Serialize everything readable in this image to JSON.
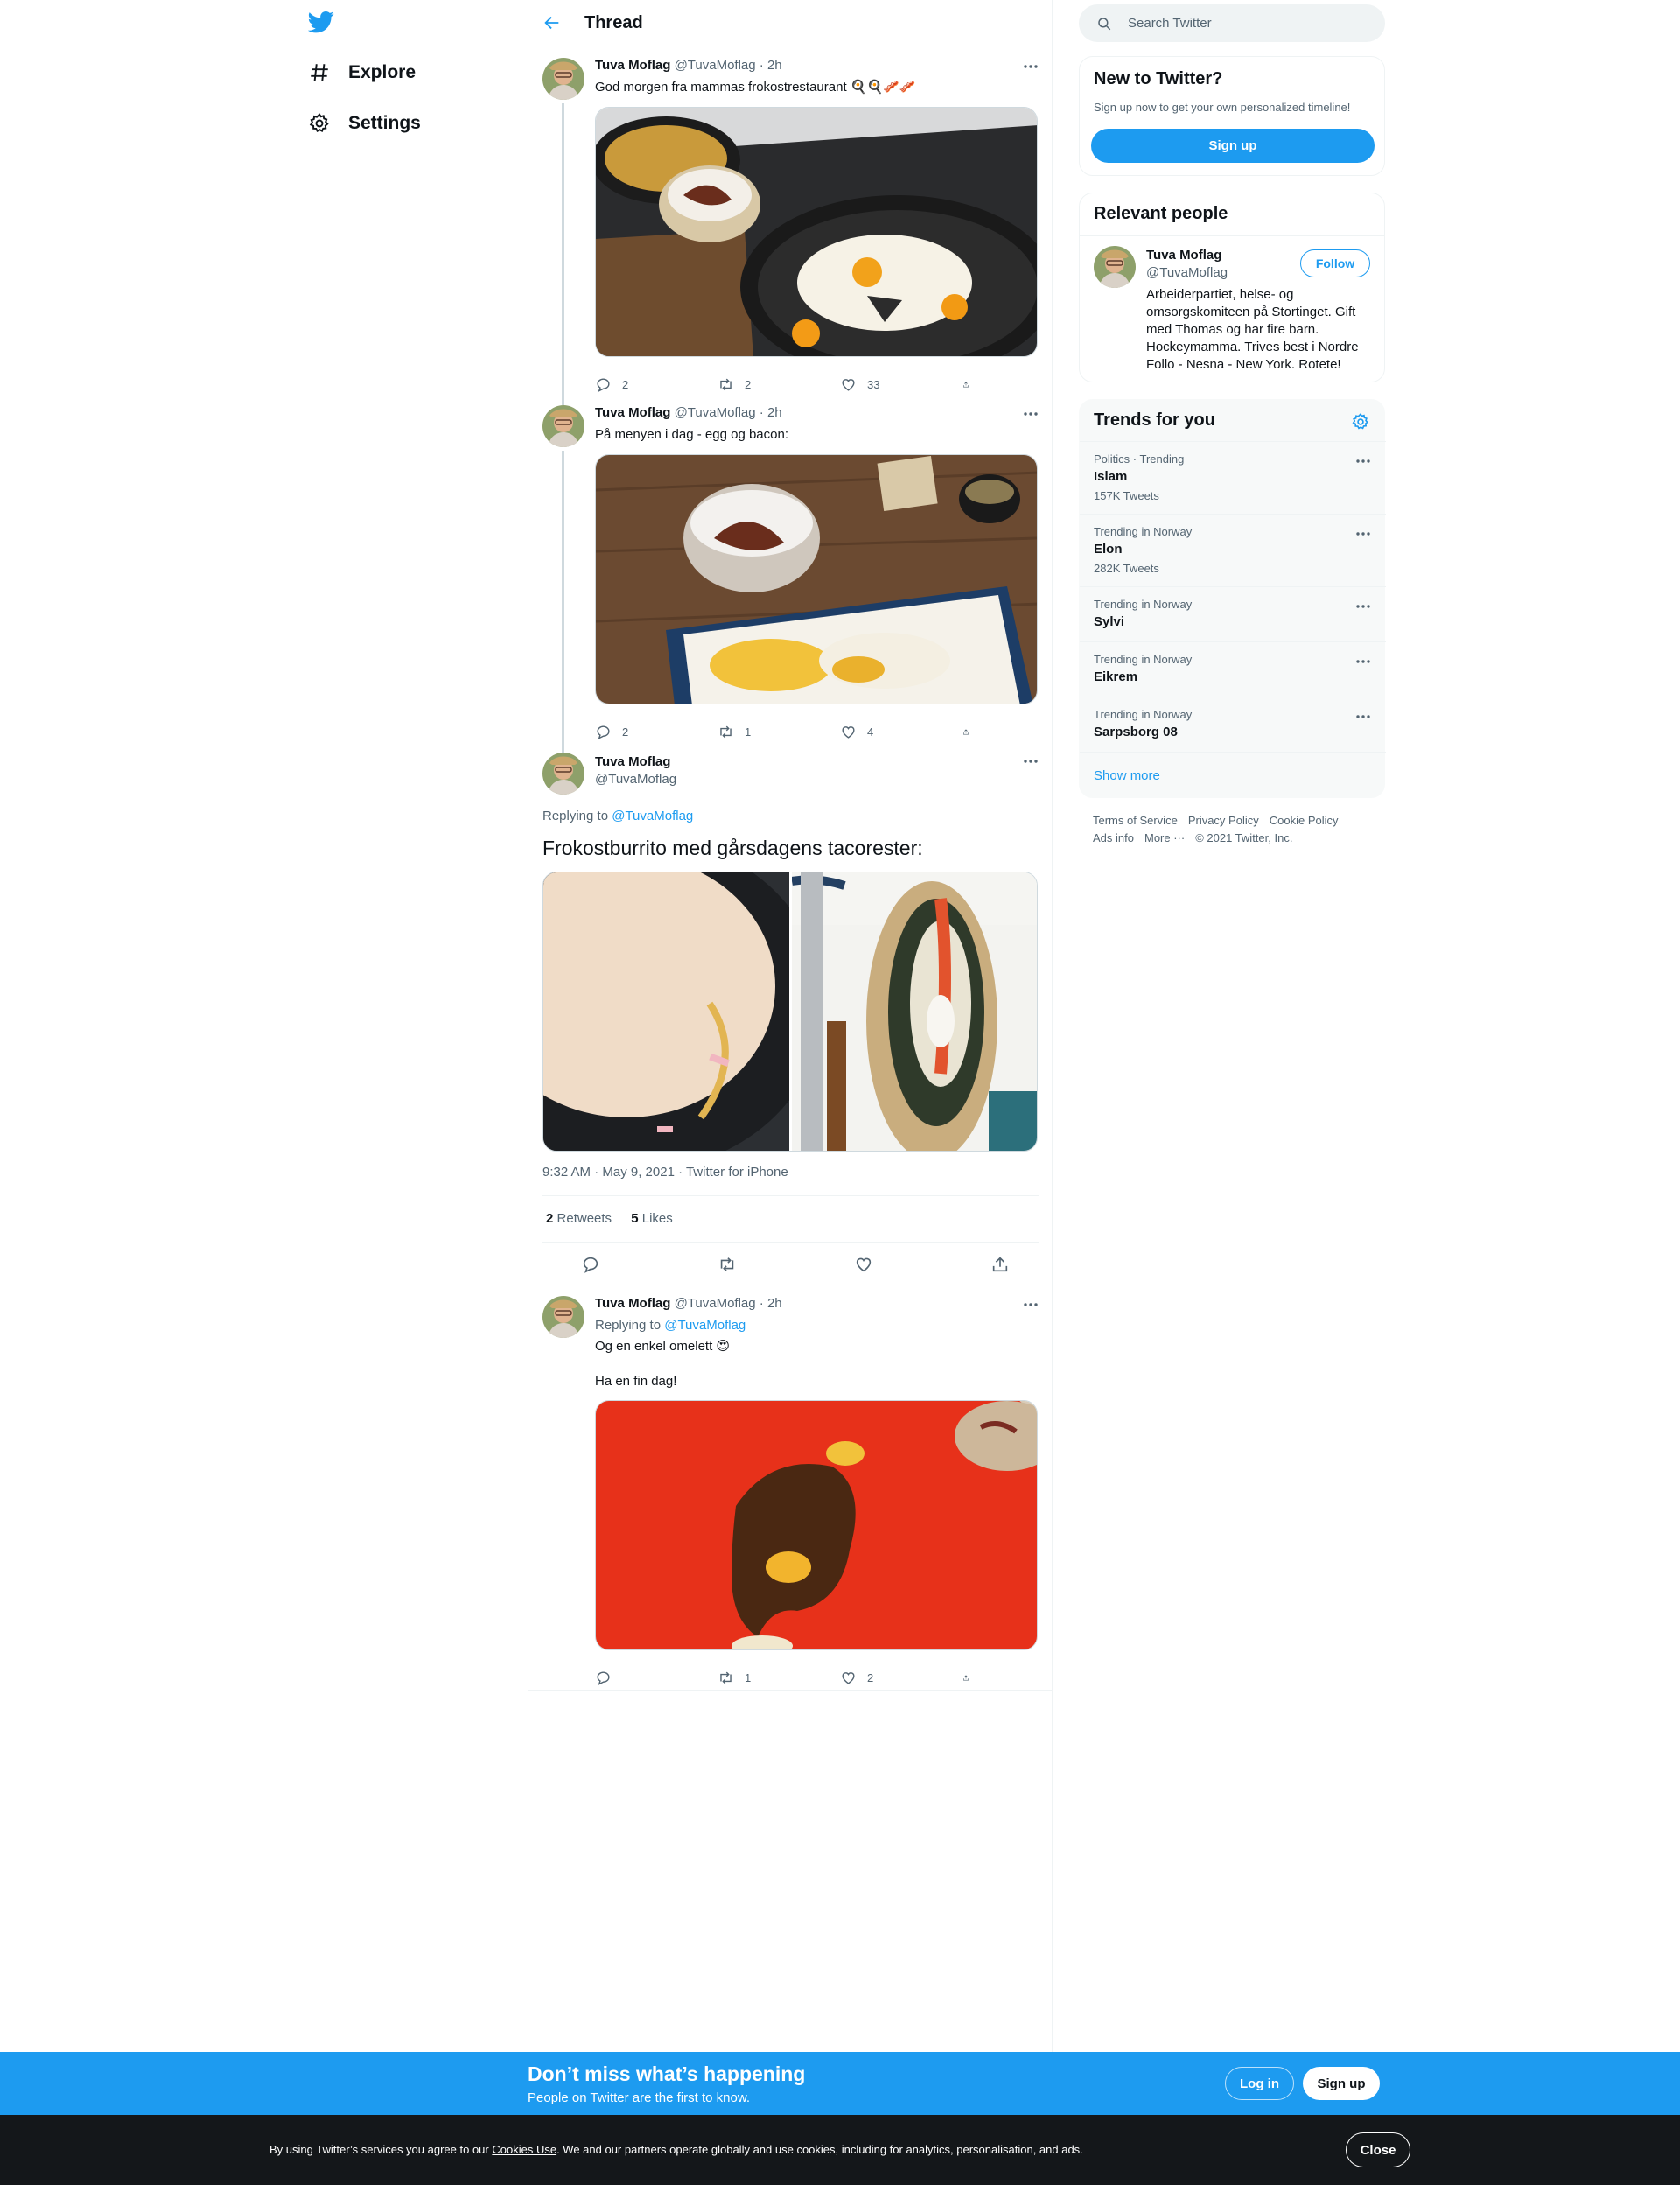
{
  "nav": {
    "logo": "twitter-bird-icon",
    "items": [
      {
        "label": "Explore",
        "icon": "hashtag-icon"
      },
      {
        "label": "Settings",
        "icon": "gear-icon"
      }
    ]
  },
  "header": {
    "title": "Thread"
  },
  "tweets": [
    {
      "name": "Tuva Moflag",
      "handle": "@TuvaMoflag",
      "time": "· 2h",
      "text": "God morgen fra mammas frokostrestaurant 🍳🍳🥓🥓",
      "replies": "2",
      "retweets": "2",
      "likes": "33"
    },
    {
      "name": "Tuva Moflag",
      "handle": "@TuvaMoflag",
      "time": "· 2h",
      "text": "På menyen i dag - egg og bacon:",
      "replies": "2",
      "retweets": "1",
      "likes": "4"
    }
  ],
  "focus": {
    "name": "Tuva Moflag",
    "handle": "@TuvaMoflag",
    "replying_prefix": "Replying to",
    "replying_to": "@TuvaMoflag",
    "text": "Frokostburrito med gårsdagens tacorester:",
    "timestamp": "9:32 AM · May 9, 2021 · Twitter for iPhone",
    "retweets_count": "2",
    "retweets_label": "Retweets",
    "likes_count": "5",
    "likes_label": "Likes"
  },
  "reply": {
    "name": "Tuva Moflag",
    "handle": "@TuvaMoflag",
    "time": "· 2h",
    "replying_prefix": "Replying to",
    "replying_to": "@TuvaMoflag",
    "text_line1": "Og en enkel omelett 😍",
    "text_line2": "Ha en fin dag!",
    "replies": "",
    "retweets": "1",
    "likes": "2"
  },
  "search": {
    "placeholder": "Search Twitter"
  },
  "new_to_twitter": {
    "title": "New to Twitter?",
    "subtitle": "Sign up now to get your own personalized timeline!",
    "button": "Sign up"
  },
  "relevant": {
    "title": "Relevant people",
    "name": "Tuva Moflag",
    "handle": "@TuvaMoflag",
    "follow": "Follow",
    "bio": "Arbeiderpartiet, helse- og omsorgskomiteen på Stortinget. Gift med Thomas og har fire barn. Hockeymamma. Trives best i Nordre Follo - Nesna - New York. Rotete!"
  },
  "trends": {
    "title": "Trends for you",
    "items": [
      {
        "category": "Politics · Trending",
        "name": "Islam",
        "count": "157K Tweets"
      },
      {
        "category": "Trending in Norway",
        "name": "Elon",
        "count": "282K Tweets"
      },
      {
        "category": "Trending in Norway",
        "name": "Sylvi",
        "count": ""
      },
      {
        "category": "Trending in Norway",
        "name": "Eikrem",
        "count": ""
      },
      {
        "category": "Trending in Norway",
        "name": "Sarpsborg 08",
        "count": ""
      }
    ],
    "show_more": "Show more"
  },
  "footer": {
    "terms": "Terms of Service",
    "privacy": "Privacy Policy",
    "cookie": "Cookie Policy",
    "ads": "Ads info",
    "more": "More ···",
    "copyright": "© 2021 Twitter, Inc."
  },
  "banner": {
    "title": "Don’t miss what’s happening",
    "subtitle": "People on Twitter are the first to know.",
    "login": "Log in",
    "signup": "Sign up"
  },
  "cookie": {
    "before": "By using Twitter’s services you agree to our ",
    "link": "Cookies Use",
    "after": ". We and our partners operate globally and use cookies, including for analytics, personalisation, and ads.",
    "close": "Close"
  },
  "colors": {
    "accent": "#1d9bf0",
    "text": "#0f1419",
    "muted": "#536471"
  }
}
